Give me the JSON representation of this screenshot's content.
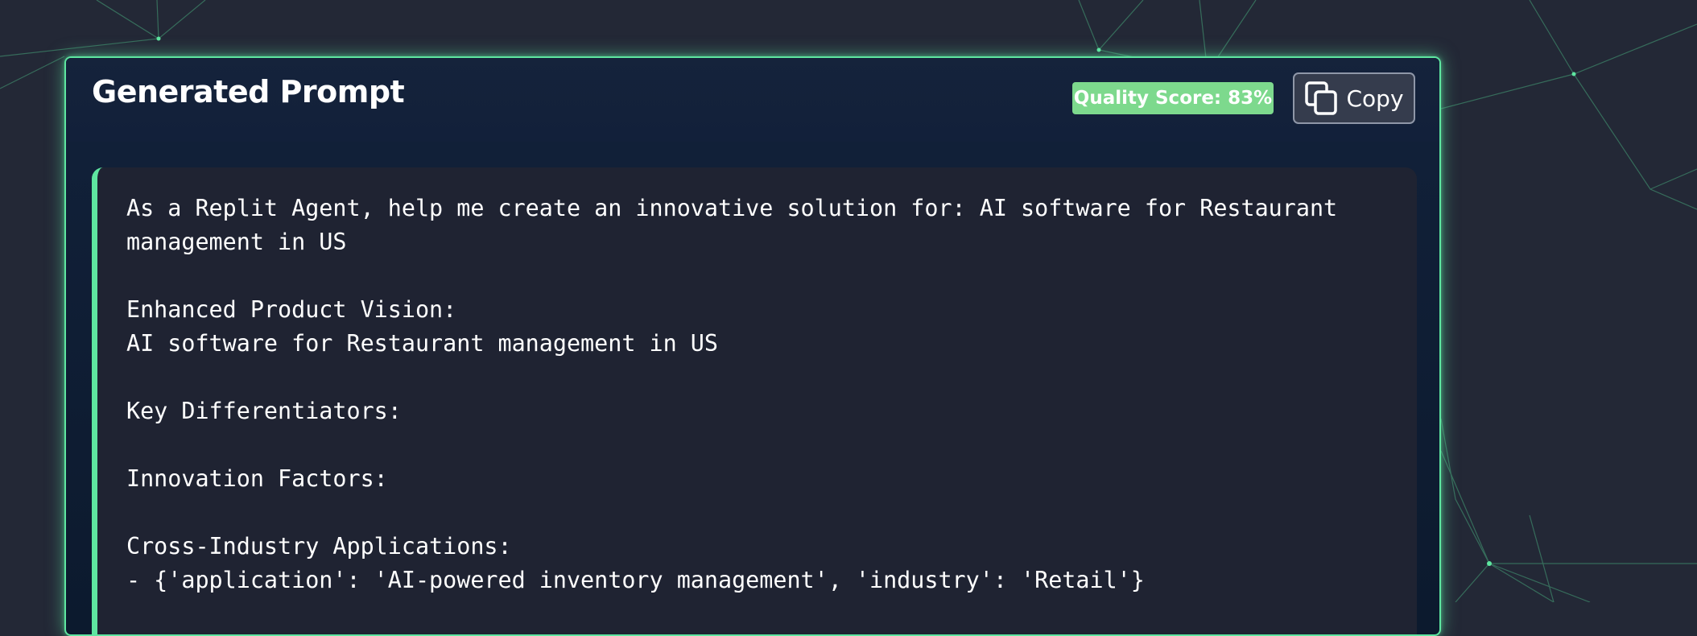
{
  "card": {
    "title": "Generated Prompt",
    "quality_badge": "Quality Score: 83%",
    "copy_label": "Copy",
    "copy_icon": "copy-icon"
  },
  "prompt": {
    "lines": [
      "As a Replit Agent, help me create an innovative solution for: AI software for Restaurant",
      "management in US",
      "",
      "Enhanced Product Vision:",
      "AI software for Restaurant management in US",
      "",
      "Key Differentiators:",
      "",
      "Innovation Factors:",
      "",
      "Cross-Industry Applications:",
      "- {'application': 'AI-powered inventory management', 'industry': 'Retail'}"
    ]
  },
  "colors": {
    "accent": "#5ee6a0",
    "badge": "#7dd98d",
    "background": "#232836",
    "card": "#12213a",
    "content": "#1f2332"
  }
}
